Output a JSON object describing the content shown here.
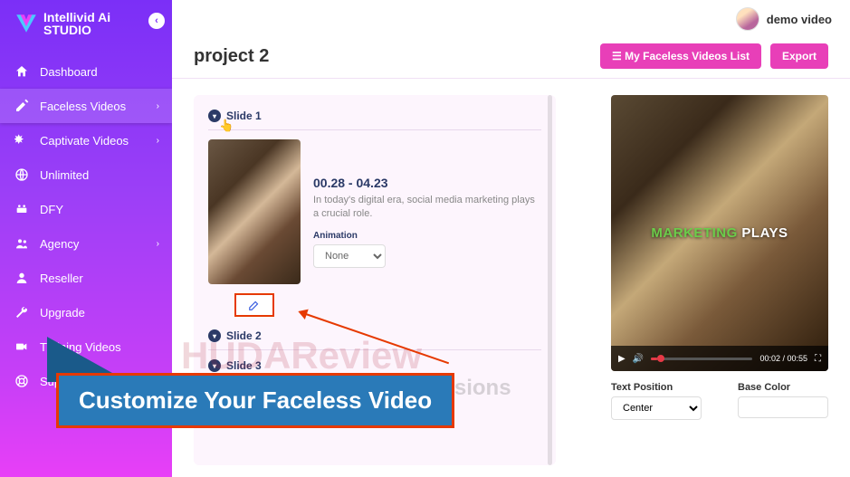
{
  "brand": {
    "name": "Intellivid Ai",
    "sub": "STUDIO"
  },
  "user": {
    "name": "demo video"
  },
  "sidebar": {
    "items": [
      {
        "label": "Dashboard",
        "icon": "home"
      },
      {
        "label": "Faceless Videos",
        "icon": "edit",
        "active": true,
        "expand": true
      },
      {
        "label": "Captivate Videos",
        "icon": "magic",
        "expand": true
      },
      {
        "label": "Unlimited",
        "icon": "globe"
      },
      {
        "label": "DFY",
        "icon": "dfy"
      },
      {
        "label": "Agency",
        "icon": "users",
        "expand": true
      },
      {
        "label": "Reseller",
        "icon": "user"
      },
      {
        "label": "Upgrade",
        "icon": "wrench"
      },
      {
        "label": "Training Videos",
        "icon": "video"
      },
      {
        "label": "Support",
        "icon": "life-ring"
      }
    ]
  },
  "page": {
    "title": "project 2",
    "list_btn": "My Faceless Videos List",
    "export_btn": "Export"
  },
  "slides": [
    {
      "label": "Slide 1",
      "timestamp": "00.28 - 04.23",
      "desc": "In today's digital era, social media marketing plays a crucial role.",
      "anim_label": "Animation",
      "anim_value": "None"
    },
    {
      "label": "Slide 2"
    },
    {
      "label": "Slide 3"
    }
  ],
  "preview": {
    "overlay_word1": "MARKETING",
    "overlay_word2": "PLAYS",
    "time": "00:02 / 00:55"
  },
  "options": {
    "text_pos_label": "Text Position",
    "text_pos_value": "Center",
    "base_color_label": "Base Color"
  },
  "callout": "Customize Your Faceless Video",
  "watermark": {
    "main": "HUDAReview",
    "sub": "Help You Make Better Decisions"
  }
}
